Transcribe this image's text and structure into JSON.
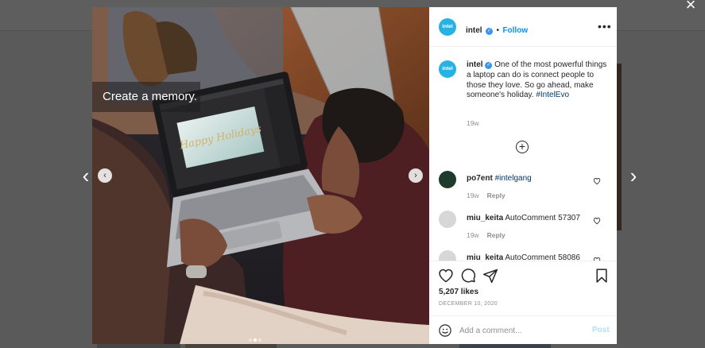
{
  "post": {
    "image_caption": "Create a memory.",
    "laptop_screen_text": "Happy Holidays",
    "carousel_dots": 3
  },
  "panel": {
    "username": "intel",
    "avatar_text": "intel",
    "follow_separator": "•",
    "follow_label": "Follow",
    "more_label": "•••",
    "caption": {
      "text": "One of the most powerful things a laptop can do is connect people to those they love. So go ahead, make someone's holiday.",
      "hashtag": "#IntelEvo",
      "time": "19w"
    },
    "comments": [
      {
        "user": "po7ent",
        "text": "#intelgang",
        "time": "19w",
        "reply": "Reply"
      },
      {
        "user": "miu_keita",
        "text": "AutoComment 57307",
        "time": "19w",
        "reply": "Reply"
      },
      {
        "user": "miu_keita",
        "text": "AutoComment 58086"
      }
    ],
    "likes": "5,207 likes",
    "date": "DECEMBER 10, 2020",
    "comment_placeholder": "Add a comment...",
    "post_label": "Post"
  },
  "icons": {
    "close": "×",
    "prev": "‹",
    "next": "›",
    "plus": "+",
    "verified": "✓"
  },
  "colors": {
    "brand": "#27b2e4",
    "link_blue": "#0095f6",
    "hashtag": "#00376b"
  }
}
